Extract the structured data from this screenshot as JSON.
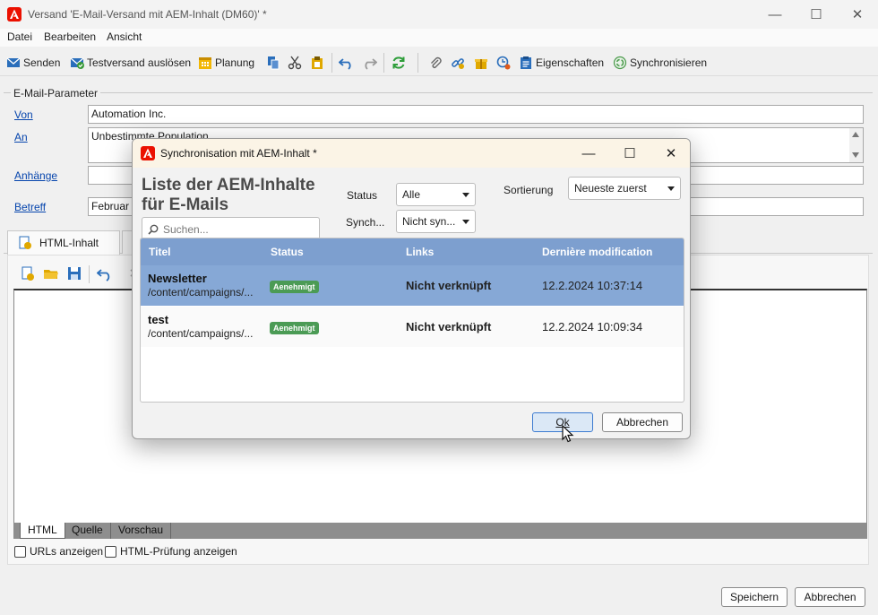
{
  "window": {
    "title": "Versand 'E-Mail-Versand mit AEM-Inhalt (DM60)' *"
  },
  "menu": [
    "Datei",
    "Bearbeiten",
    "Ansicht"
  ],
  "toolbar": {
    "send": "Senden",
    "test_send": "Testversand auslösen",
    "schedule": "Planung",
    "properties": "Eigenschaften",
    "synchronize": "Synchronisieren"
  },
  "params": {
    "legend": "E-Mail-Parameter",
    "from_label": "Von",
    "from_value": "Automation Inc.",
    "to_label": "An",
    "to_value": "Unbestimmte Population",
    "attachments_label": "Anhänge",
    "attachments_value": "",
    "subject_label": "Betreff",
    "subject_value": "Februar"
  },
  "content_tab": "HTML-Inhalt",
  "editor_tabs": [
    "HTML",
    "Quelle",
    "Vorschau"
  ],
  "checkboxes": {
    "show_urls": "URLs anzeigen",
    "html_check": "HTML-Prüfung anzeigen"
  },
  "footer": {
    "save": "Speichern",
    "cancel": "Abbrechen"
  },
  "modal": {
    "title": "Synchronisation mit AEM-Inhalt *",
    "heading_line1": "Liste der AEM-Inhalte",
    "heading_line2": "für E-Mails",
    "search_placeholder": "Suchen...",
    "filters": {
      "status_label": "Status",
      "status_value": "Alle",
      "sync_label": "Synch...",
      "sync_value": "Nicht syn...",
      "sort_label": "Sortierung",
      "sort_value": "Neueste zuerst"
    },
    "columns": [
      "Titel",
      "Status",
      "Links",
      "Dernière modification"
    ],
    "rows": [
      {
        "title": "Newsletter",
        "path": "/content/campaigns/...",
        "status": "Aenehmigt",
        "links": "Nicht verknüpft",
        "modified": "12.2.2024 10:37:14",
        "selected": true
      },
      {
        "title": "test",
        "path": "/content/campaigns/...",
        "status": "Aenehmigt",
        "links": "Nicht verknüpft",
        "modified": "12.2.2024 10:09:34",
        "selected": false
      }
    ],
    "ok": "Ok",
    "cancel": "Abbrechen"
  },
  "colors": {
    "accent": "#eb1000",
    "grid_header": "#7d9fcf",
    "selected_row": "#86a8d6",
    "badge": "#4b9b55",
    "link": "#0645ad"
  }
}
